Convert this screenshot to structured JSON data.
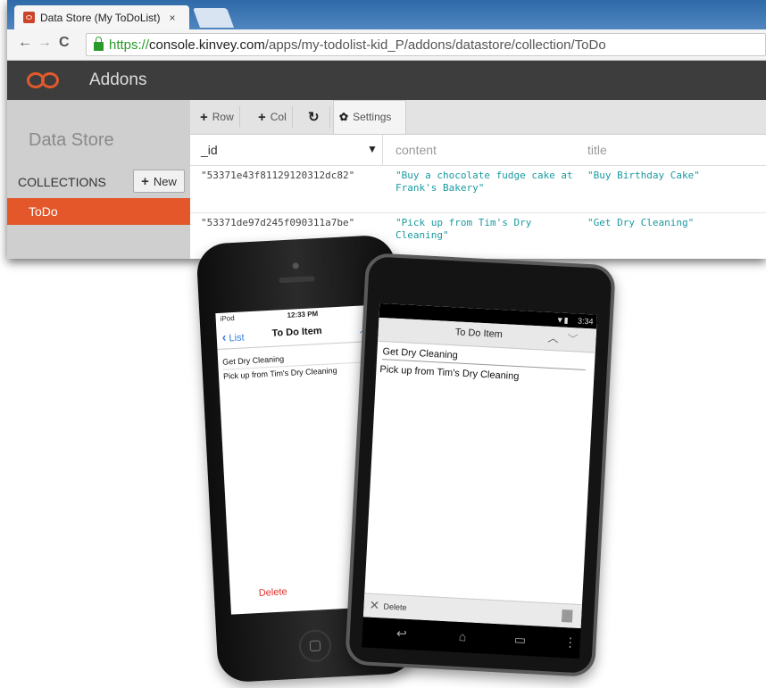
{
  "browser": {
    "tab_title": "Data Store (My ToDoList)",
    "tab_close": "×",
    "url_scheme": "https://",
    "url_host": "console.kinvey.com",
    "url_path": "/apps/my-todolist-kid_P/addons/datastore/collection/ToDo"
  },
  "app": {
    "title": "Addons",
    "brand_color": "#e3572b"
  },
  "sidebar": {
    "title": "Data Store",
    "collections_label": "COLLECTIONS",
    "new_button": "New",
    "items": [
      {
        "label": "ToDo"
      }
    ]
  },
  "grid": {
    "toolbar": {
      "row": "Row",
      "col": "Col",
      "settings": "Settings"
    },
    "columns": [
      "_id",
      "content",
      "title"
    ],
    "rows": [
      {
        "id": "\"53371e43f81129120312dc82\"",
        "content": "\"Buy a chocolate fudge cake at Frank's Bakery\"",
        "title": "\"Buy Birthday Cake\""
      },
      {
        "id": "\"53371de97d245f090311a7be\"",
        "content": "\"Pick up from Tim's Dry Cleaning\"",
        "title": "\"Get Dry Cleaning\""
      }
    ]
  },
  "iphone": {
    "carrier": "iPod",
    "time": "12:33 PM",
    "back_label": "List",
    "title": "To Do Item",
    "title_field": "Get Dry Cleaning",
    "content_field": "Pick up from Tim's Dry Cleaning",
    "delete_label": "Delete"
  },
  "android": {
    "clock": "3:34",
    "title": "To Do Item",
    "title_field": "Get Dry Cleaning",
    "content_field": "Pick up from Tim's Dry Cleaning",
    "delete_label": "Delete"
  }
}
